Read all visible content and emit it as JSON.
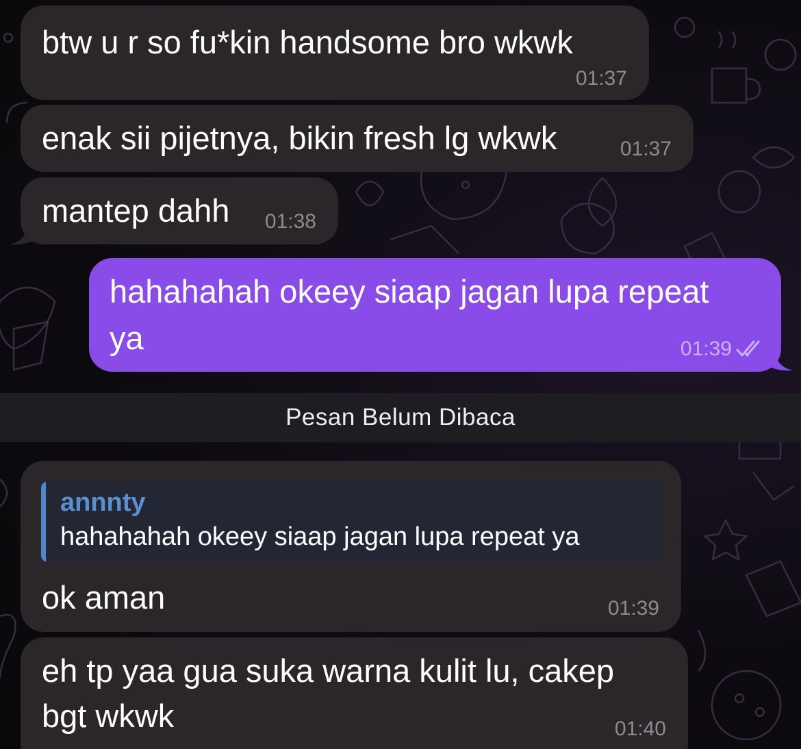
{
  "colors": {
    "incoming_bubble": "#2b2629",
    "outgoing_bubble": "#8a4ce8",
    "unread_divider": "#1e1d21",
    "reply_accent": "#4e87cc"
  },
  "messages": [
    {
      "text": "btw u r so fu*kin handsome bro wkwk",
      "time": "01:37"
    },
    {
      "text": "enak sii pijetnya, bikin fresh lg wkwk",
      "time": "01:37"
    },
    {
      "text": "mantep dahh",
      "time": "01:38"
    },
    {
      "line1": "hahahahah okeey siaap jagan lupa repeat",
      "line2": "ya",
      "time": "01:39",
      "status_icon": "double-check-icon"
    },
    {
      "reply_name": "annnty",
      "reply_text": "hahahahah okeey siaap jagan lupa repeat ya",
      "text": "ok aman",
      "time": "01:39"
    },
    {
      "line1": "eh tp yaa gua suka warna kulit lu, cakep",
      "line2": "bgt wkwk",
      "time": "01:40"
    }
  ],
  "unread_divider": "Pesan Belum Dibaca"
}
